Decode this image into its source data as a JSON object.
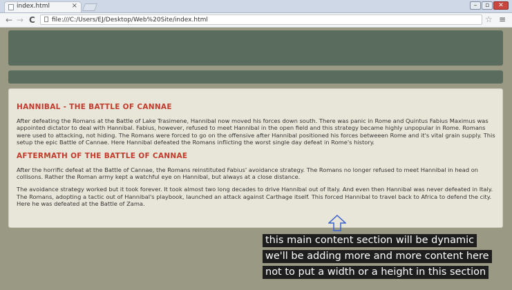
{
  "browser": {
    "tab_title": "index.html",
    "tab_close": "×",
    "url": "file:///C:/Users/EJ/Desktop/Web%20Site/index.html",
    "controls": {
      "minimize": "–",
      "maximize": "▫",
      "close": "✕"
    }
  },
  "main": {
    "sections": [
      {
        "heading": "HANNIBAL - THE BATTLE OF CANNAE",
        "paragraphs": [
          "After defeating the Romans at the Battle of Lake Trasimene, Hannibal now moved his forces down south. There was panic in Rome and Quintus Fabius Maximus was appointed dictator to deal with Hannibal. Fabius, however, refused to meet Hannibal in the open field and this strategy became highly unpopular in Rome. Romans were used to attacking, not hiding. The Romans were forced to go on the offensive after Hannibal positioned his forces betweeen Rome and it's vital grain supply. This setup the epic Battle of Cannae. Here Hannibal defeated the Romans inflicting the worst single day defeat in Rome's history."
        ]
      },
      {
        "heading": "AFTERMATH OF THE BATTLE OF CANNAE",
        "paragraphs": [
          "After the horrific defeat at the Battle of Cannae, the Romans reinstituted Fabius' avoidance strategy. The Romans no longer refused to meet Hannibal in head on collisons. Rather the Roman army kept a watchful eye on Hannibal, but always at a close distance.",
          "The avoidance strategy worked but it took forever. It took almost two long decades to drive Hannibal out of Italy. And even then Hannibal was never defeated in Italy. The Romans, adopting a tactic out of Hannibal's playbook, launched an attack against Carthage itself. This forced Hannibal to travel back to Africa to defend the city. Here he was defeated at the Battle of Zama."
        ]
      }
    ]
  },
  "caption": {
    "lines": [
      "this main content section will be dynamic",
      "we'll be adding more and more content here",
      "not to put a width or a height in this section"
    ]
  },
  "colors": {
    "page_background": "#9a9a84",
    "header": "#5a6c5e",
    "content_background": "#e8e6d8",
    "heading": "#c23a2c",
    "caption_background": "#1e1e1e"
  },
  "icons": [
    "page-icon",
    "close-icon",
    "back-arrow-icon",
    "forward-arrow-icon",
    "reload-icon",
    "star-icon",
    "menu-icon",
    "up-arrow-icon"
  ]
}
